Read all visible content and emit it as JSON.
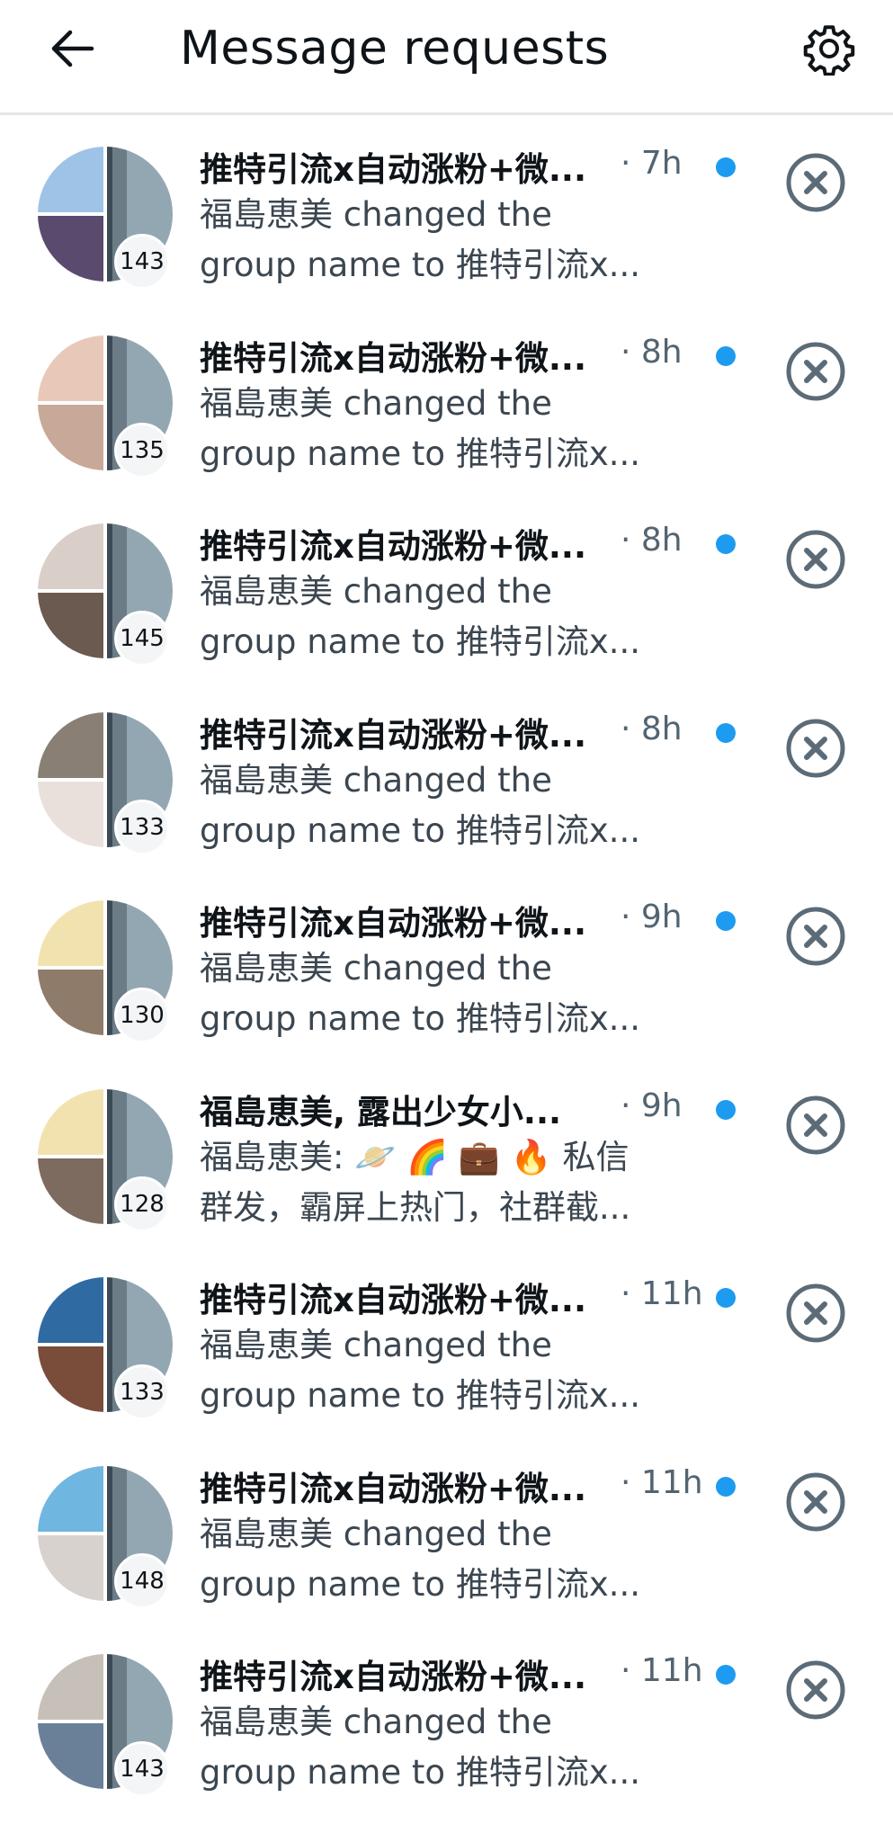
{
  "header": {
    "title": "Message requests",
    "back_icon": "arrow-left-icon",
    "settings_icon": "gear-icon"
  },
  "colors": {
    "unread_dot": "#1d9bf0",
    "secondary_text": "#536471",
    "dismiss_icon": "#5b6b78"
  },
  "requests": [
    {
      "title": "推特引流x自动涨粉+微...",
      "time": "· 7h",
      "line1": "福島恵美 changed the",
      "line2": "group name to 推特引流x...",
      "member_count": "143",
      "unread": true
    },
    {
      "title": "推特引流x自动涨粉+微...",
      "time": "· 8h",
      "line1": "福島恵美 changed the",
      "line2": "group name to 推特引流x...",
      "member_count": "135",
      "unread": true
    },
    {
      "title": "推特引流x自动涨粉+微...",
      "time": "· 8h",
      "line1": "福島恵美 changed the",
      "line2": "group name to 推特引流x...",
      "member_count": "145",
      "unread": true
    },
    {
      "title": "推特引流x自动涨粉+微...",
      "time": "· 8h",
      "line1": "福島恵美 changed the",
      "line2": "group name to 推特引流x...",
      "member_count": "133",
      "unread": true
    },
    {
      "title": "推特引流x自动涨粉+微...",
      "time": "· 9h",
      "line1": "福島恵美 changed the",
      "line2": "group name to 推特引流x...",
      "member_count": "130",
      "unread": true
    },
    {
      "title": "福島恵美, 露出少女小...",
      "time": "· 9h",
      "line1": "福島恵美: 🪐 🌈 💼 🔥 私信",
      "line2": "群发，霸屏上热门，社群截...",
      "member_count": "128",
      "unread": true
    },
    {
      "title": "推特引流x自动涨粉+微...",
      "time": "· 11h",
      "line1": "福島恵美 changed the",
      "line2": "group name to 推特引流x...",
      "member_count": "133",
      "unread": true
    },
    {
      "title": "推特引流x自动涨粉+微...",
      "time": "· 11h",
      "line1": "福島恵美 changed the",
      "line2": "group name to 推特引流x...",
      "member_count": "148",
      "unread": true
    },
    {
      "title": "推特引流x自动涨粉+微...",
      "time": "· 11h",
      "line1": "福島恵美 changed the",
      "line2": "group name to 推特引流x...",
      "member_count": "143",
      "unread": true
    }
  ]
}
